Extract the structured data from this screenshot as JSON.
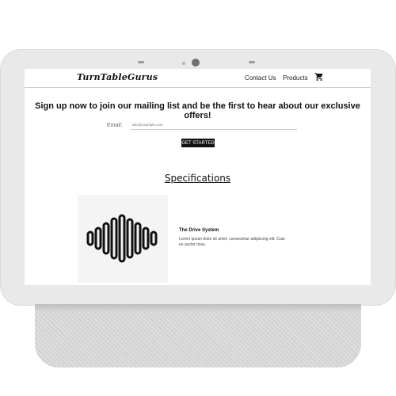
{
  "nav": {
    "logo": "TurnTableGurus",
    "links": [
      "Contact Us",
      "Products"
    ]
  },
  "signup": {
    "headline": "Sign up now to join our mailing list and be the first to hear about our exclusive offers!",
    "email_label": "Email:",
    "email_placeholder": "abc@example.com",
    "cta_label": "GET STARTED"
  },
  "specifications": {
    "title": "Specifications",
    "item_title": "The Drive System",
    "item_text": "Lorem ipsum dolor sit amet, consectetur adipiscing elit. Cras eu auctor risus."
  },
  "icons": {
    "cart": "cart-icon",
    "soundwave": "soundwave-icon"
  },
  "colors": {
    "device_frame": "#e9e9e9",
    "stand": "#d8d8d8",
    "accent": "#111111"
  }
}
